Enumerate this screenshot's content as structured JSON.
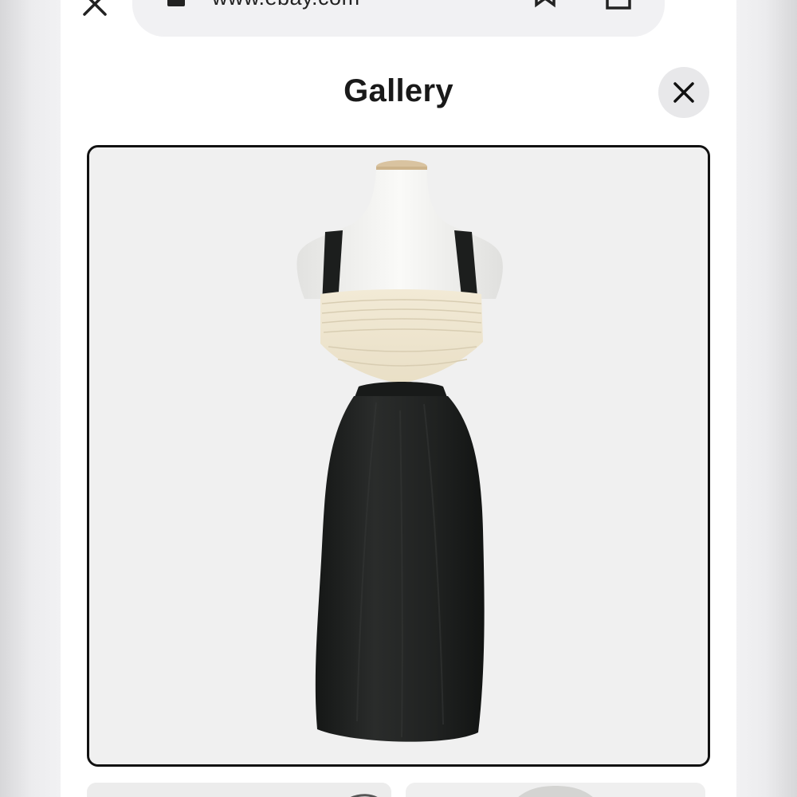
{
  "browser": {
    "url": "www.ebay.com"
  },
  "gallery": {
    "title": "Gallery"
  },
  "images": {
    "main_alt": "",
    "thumbnail_count_visible": 2
  },
  "colors": {
    "bar_bg": "#f1f1f3",
    "dress_black": "#1f2120",
    "bodice_cream": "#efe6d2",
    "mannequin": "#f6f6f4"
  },
  "icons": {
    "top_left": "close-icon",
    "lock": "lock-icon",
    "bookmark": "bookmark-icon",
    "share": "share-icon",
    "gallery_close": "close-icon"
  }
}
